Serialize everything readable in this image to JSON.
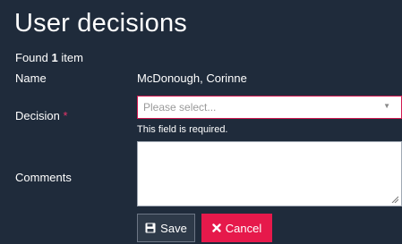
{
  "page": {
    "title": "User decisions"
  },
  "results": {
    "prefix": "Found",
    "count": "1",
    "suffix": "item"
  },
  "fields": {
    "name": {
      "label": "Name",
      "value": "McDonough, Corinne"
    },
    "decision": {
      "label": "Decision",
      "required_marker": "*",
      "placeholder": "Please select...",
      "error": "This field is required."
    },
    "comments": {
      "label": "Comments",
      "value": ""
    }
  },
  "buttons": {
    "save": {
      "label": "Save",
      "icon": "floppy-disk-icon"
    },
    "cancel": {
      "label": "Cancel",
      "icon": "x-icon"
    }
  },
  "colors": {
    "background": "#1f2b3b",
    "error_accent": "#d21a52",
    "cancel": "#e6194b"
  }
}
